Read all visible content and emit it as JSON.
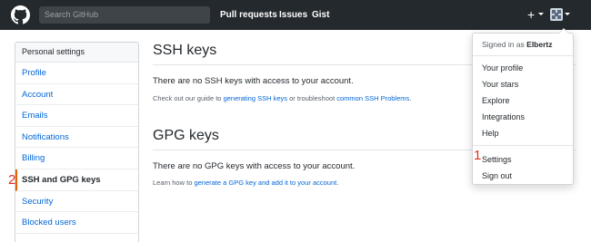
{
  "header": {
    "search_placeholder": "Search GitHub",
    "nav": [
      "Pull requests",
      "Issues",
      "Gist"
    ],
    "plus_symbol": "+",
    "bg_color": "#24292e"
  },
  "sidebar": {
    "heading": "Personal settings",
    "items": [
      {
        "label": "Profile"
      },
      {
        "label": "Account"
      },
      {
        "label": "Emails"
      },
      {
        "label": "Notifications"
      },
      {
        "label": "Billing"
      },
      {
        "label": "SSH and GPG keys",
        "active": true
      },
      {
        "label": "Security"
      },
      {
        "label": "Blocked users"
      }
    ]
  },
  "ssh": {
    "title": "SSH keys",
    "empty": "There are no SSH keys with access to your account.",
    "note_pre": "Check out our guide to ",
    "note_link1": "generating SSH keys",
    "note_mid": " or troubleshoot ",
    "note_link2": "common SSH Problems",
    "note_post": "."
  },
  "gpg": {
    "title": "GPG keys",
    "empty": "There are no GPG keys with access to your account.",
    "note_pre": "Learn how to ",
    "note_link": "generate a GPG key and add it to your account",
    "note_post": "."
  },
  "dropdown": {
    "signed_in_prefix": "Signed in as ",
    "username": "Elbertz",
    "group1": [
      "Your profile",
      "Your stars",
      "Explore",
      "Integrations",
      "Help"
    ],
    "group2": [
      "Settings",
      "Sign out"
    ]
  },
  "annotations": {
    "one": "1",
    "two": "2",
    "color": "#e0301e"
  }
}
